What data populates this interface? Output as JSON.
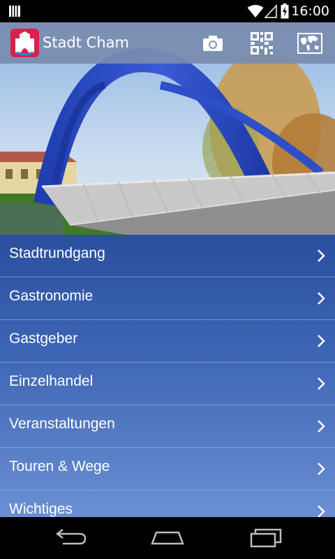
{
  "status_bar": {
    "time": "16:00",
    "icons": [
      "notification-icon",
      "wifi-icon",
      "signal-icon",
      "battery-charging-icon"
    ]
  },
  "action_bar": {
    "title": "Stadt Cham",
    "logo_icon": "city-logo-icon",
    "actions": [
      "camera-icon",
      "qr-code-icon",
      "map-icon"
    ],
    "color": "#7f93b8"
  },
  "hero": {
    "image": "bridge-photo"
  },
  "menu": {
    "items": [
      {
        "label": "Stadtrundgang"
      },
      {
        "label": "Gastronomie"
      },
      {
        "label": "Gastgeber"
      },
      {
        "label": "Einzelhandel"
      },
      {
        "label": "Veranstaltungen"
      },
      {
        "label": "Touren & Wege"
      },
      {
        "label": "Wichtiges"
      }
    ],
    "chevron_icon": "chevron-right-icon",
    "accent": "#2b4f9f"
  },
  "nav_bar": {
    "icons": [
      "back-icon",
      "home-icon",
      "recent-apps-icon"
    ]
  }
}
